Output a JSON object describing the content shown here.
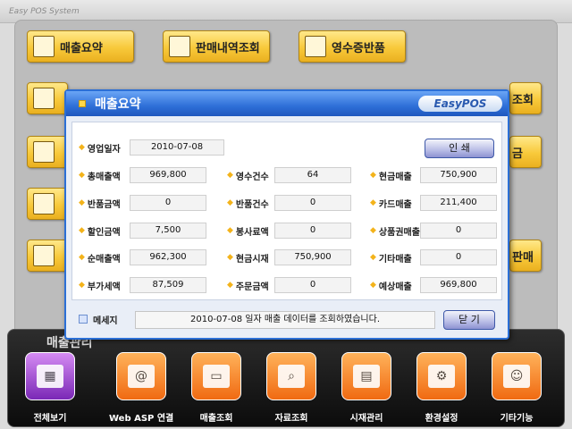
{
  "window": {
    "title": "Easy POS System"
  },
  "top_buttons": [
    {
      "label": "매출요약",
      "icon": "document-icon"
    },
    {
      "label": "판매내역조회",
      "icon": "receipt-icon"
    },
    {
      "label": "영수증반품",
      "icon": "return-icon"
    }
  ],
  "side_partials": [
    "조회",
    "금",
    "판매"
  ],
  "dialog": {
    "title": "매출요약",
    "logo": "EasyPOS",
    "business_date_label": "영업일자",
    "business_date": "2010-07-08",
    "print_button": "인  쇄",
    "fields": [
      {
        "label": "총매출액",
        "value": "969,800"
      },
      {
        "label": "영수건수",
        "value": "64"
      },
      {
        "label": "현금매출",
        "value": "750,900"
      },
      {
        "label": "반품금액",
        "value": "0"
      },
      {
        "label": "반품건수",
        "value": "0"
      },
      {
        "label": "카드매출",
        "value": "211,400"
      },
      {
        "label": "할인금액",
        "value": "7,500"
      },
      {
        "label": "봉사료액",
        "value": "0"
      },
      {
        "label": "상품권매출",
        "value": "0"
      },
      {
        "label": "순매출액",
        "value": "962,300"
      },
      {
        "label": "현금시재",
        "value": "750,900"
      },
      {
        "label": "기타매출",
        "value": "0"
      },
      {
        "label": "부가세액",
        "value": "87,509"
      },
      {
        "label": "주문금액",
        "value": "0"
      },
      {
        "label": "예상매출",
        "value": "969,800"
      }
    ],
    "message_label": "메세지",
    "message": "2010-07-08 일자 매출 데이터를 조회하였습니다.",
    "close_button": "닫  기"
  },
  "bottom": {
    "title": "매출관리",
    "nav": [
      {
        "label": "전체보기",
        "icon": "grid-icon",
        "glyph": "▦"
      },
      {
        "label": "Web ASP 연결",
        "icon": "web-icon",
        "glyph": "@"
      },
      {
        "label": "매출조회",
        "icon": "monitor-icon",
        "glyph": "▭"
      },
      {
        "label": "자료조회",
        "icon": "folder-search-icon",
        "glyph": "⌕"
      },
      {
        "label": "시재관리",
        "icon": "calculator-icon",
        "glyph": "▤"
      },
      {
        "label": "환경설정",
        "icon": "gear-icon",
        "glyph": "⚙"
      },
      {
        "label": "기타기능",
        "icon": "users-icon",
        "glyph": "☺"
      }
    ]
  }
}
